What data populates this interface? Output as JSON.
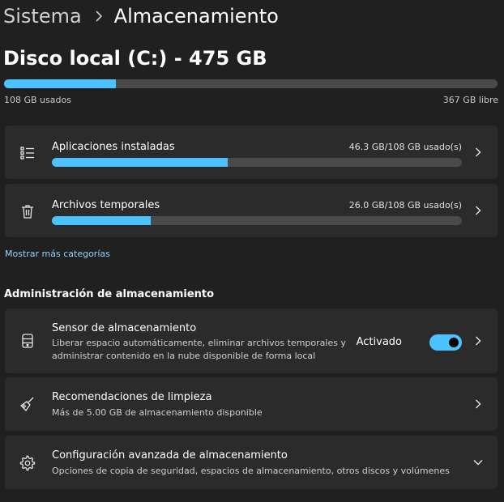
{
  "breadcrumb": {
    "parent": "Sistema",
    "current": "Almacenamiento"
  },
  "disk": {
    "title": "Disco local (C:) - 475 GB",
    "used_label": "108 GB usados",
    "free_label": "367 GB libre",
    "used_fraction": 0.227
  },
  "categories": [
    {
      "title": "Aplicaciones instaladas",
      "usage": "46.3 GB/108 GB usado(s)",
      "fraction": 0.429,
      "icon": "list-icon"
    },
    {
      "title": "Archivos temporales",
      "usage": "26.0 GB/108 GB usado(s)",
      "fraction": 0.241,
      "icon": "trash-icon"
    }
  ],
  "more_link": "Mostrar más categorías",
  "management": {
    "heading": "Administración de almacenamiento",
    "sensor": {
      "title": "Sensor de almacenamiento",
      "desc_line1": "Liberar espacio automáticamente, eliminar archivos temporales y",
      "desc_line2": "administrar contenido en la nube disponible de forma local",
      "toggle_label": "Activado",
      "toggle_on": true,
      "icon": "server-icon"
    },
    "cleanup": {
      "title": "Recomendaciones de limpieza",
      "desc": "Más de 5.00 GB de almacenamiento disponible",
      "icon": "broom-icon"
    },
    "advanced": {
      "title": "Configuración avanzada de almacenamiento",
      "desc": "Opciones de copia de seguridad, espacios de almacenamiento, otros discos y volúmenes",
      "icon": "gear-icon"
    }
  },
  "colors": {
    "accent": "#4cc2ff",
    "card": "#2b2b2b",
    "background": "#202020",
    "track": "#4a4a4a"
  }
}
